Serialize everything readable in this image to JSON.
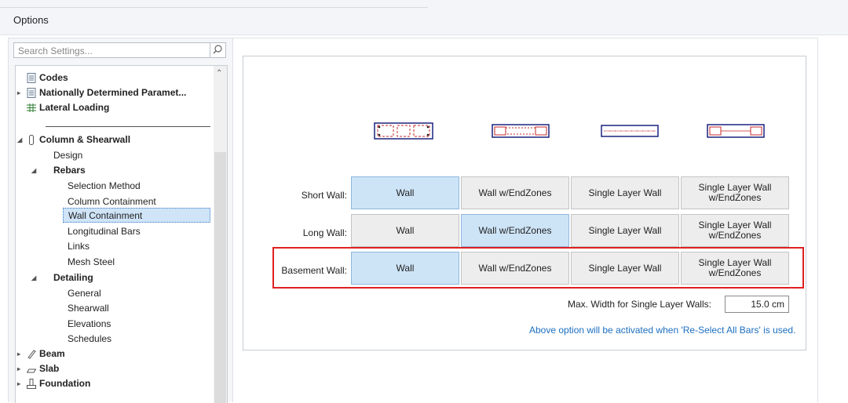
{
  "window": {
    "title": "Options"
  },
  "search": {
    "placeholder": "Search Settings..."
  },
  "tree": [
    {
      "label": "Codes"
    },
    {
      "label": "Nationally Determined Paramet..."
    },
    {
      "label": "Lateral Loading"
    },
    {
      "label": "Column & Shearwall"
    },
    {
      "label": "Design"
    },
    {
      "label": "Rebars"
    },
    {
      "label": "Selection Method"
    },
    {
      "label": "Column Containment"
    },
    {
      "label": "Wall Containment"
    },
    {
      "label": "Longitudinal Bars"
    },
    {
      "label": "Links"
    },
    {
      "label": "Mesh Steel"
    },
    {
      "label": "Detailing"
    },
    {
      "label": "General"
    },
    {
      "label": "Shearwall"
    },
    {
      "label": "Elevations"
    },
    {
      "label": "Schedules"
    },
    {
      "label": "Beam"
    },
    {
      "label": "Slab"
    },
    {
      "label": "Foundation"
    }
  ],
  "selected_item": "Wall Containment",
  "columns": [
    "Wall",
    "Wall w/EndZones",
    "Single Layer Wall",
    "Single Layer Wall w/EndZones"
  ],
  "rows": [
    {
      "label": "Short Wall:",
      "selected": "Wall"
    },
    {
      "label": "Long Wall:",
      "selected": "Wall w/EndZones"
    },
    {
      "label": "Basement Wall:",
      "selected": "Wall"
    }
  ],
  "max_width": {
    "label": "Max. Width for Single Layer Walls:",
    "value": "15.0 cm"
  },
  "note": "Above option will be activated when 'Re-Select All Bars' is used.",
  "colors": {
    "accent": "#1c6fc0",
    "highlight": "#e02020",
    "selected": "#cde4f7"
  }
}
